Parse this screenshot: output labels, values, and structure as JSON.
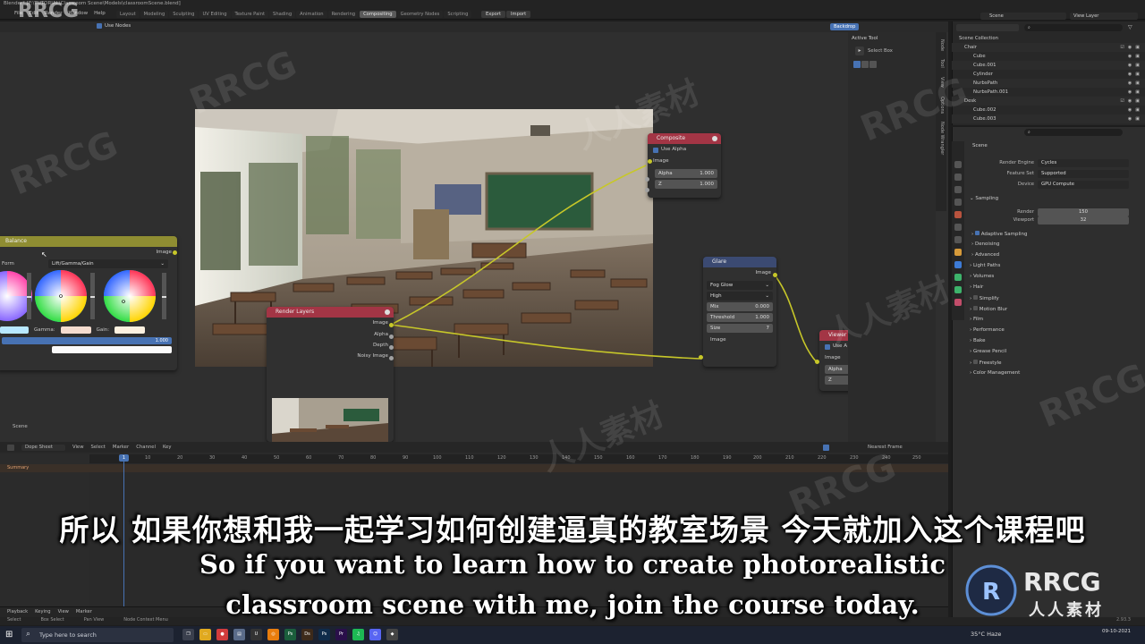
{
  "titlebar": {
    "title": "Blender* [F:\\TUTORIAL\\Classroom Scene\\Models\\classroomScene.blend]"
  },
  "menus": [
    "File",
    "Edit",
    "Render",
    "Window",
    "Help"
  ],
  "workspaces": [
    "Layout",
    "Modeling",
    "Sculpting",
    "UV Editing",
    "Texture Paint",
    "Shading",
    "Animation",
    "Rendering",
    "Compositing",
    "Geometry Nodes",
    "Scripting"
  ],
  "active_workspace": "Compositing",
  "import_export": {
    "export": "Export",
    "import": "Import"
  },
  "scene_selector": "Scene",
  "view_layer_selector": "View Layer",
  "node_editor": {
    "use_nodes": "Use Nodes",
    "backdrop": "Backdrop",
    "scene_label": "Scene",
    "nodes": {
      "color_balance": {
        "title": "Balance",
        "output": "Image",
        "formula_label": "Form",
        "formula_value": "Lift/Gamma/Gain",
        "gamma": "Gamma:",
        "gain": "Gain:",
        "fac": "1.000"
      },
      "composite": {
        "title": "Composite",
        "use_alpha": "Use Alpha",
        "image": "Image",
        "alpha": "Alpha",
        "alpha_val": "1.000",
        "z": "Z",
        "z_val": "1.000"
      },
      "glare": {
        "title": "Glare",
        "output": "Image",
        "type": "Fog Glow",
        "quality": "High",
        "mix": "Mix",
        "mix_val": "0.000",
        "threshold": "Threshold",
        "threshold_val": "1.000",
        "size": "Size",
        "size_val": "7",
        "input": "Image"
      },
      "render_layers": {
        "title": "Render Layers",
        "outputs": [
          "Image",
          "Alpha",
          "Depth",
          "Noisy Image"
        ]
      },
      "viewer": {
        "title": "Viewer",
        "use_alpha": "Use A",
        "image": "Image",
        "alpha": "Alpha",
        "z": "Z"
      }
    }
  },
  "npanel": {
    "tabs": [
      "Node",
      "Tool",
      "View",
      "Options",
      "Node Wrangler"
    ],
    "active_tool": "Active Tool",
    "select_box": "Select Box"
  },
  "outliner": {
    "rows": [
      {
        "label": "Scene Collection",
        "indent": 0
      },
      {
        "label": "Chair",
        "indent": 1
      },
      {
        "label": "Cube",
        "indent": 2
      },
      {
        "label": "Cube.001",
        "indent": 2
      },
      {
        "label": "Cylinder",
        "indent": 2
      },
      {
        "label": "NurbsPath",
        "indent": 2
      },
      {
        "label": "NurbsPath.001",
        "indent": 2
      },
      {
        "label": "Desk",
        "indent": 1
      },
      {
        "label": "Cube.002",
        "indent": 2
      },
      {
        "label": "Cube.003",
        "indent": 2
      }
    ]
  },
  "properties": {
    "context": "Scene",
    "render_engine_label": "Render Engine",
    "render_engine": "Cycles",
    "feature_set_label": "Feature Set",
    "feature_set": "Supported",
    "device_label": "Device",
    "device": "GPU Compute",
    "sampling": "Sampling",
    "render_label": "Render",
    "render_samples": "150",
    "viewport_label": "Viewport",
    "viewport_samples": "32",
    "panels": [
      "Adaptive Sampling",
      "Denoising",
      "Advanced",
      "Light Paths",
      "Volumes",
      "Hair",
      "Simplify",
      "Motion Blur",
      "Film",
      "Performance",
      "Bake",
      "Grease Pencil",
      "Freestyle",
      "Color Management"
    ]
  },
  "dope_sheet": {
    "mode": "Dope Sheet",
    "menus": [
      "View",
      "Select",
      "Marker",
      "Channel",
      "Key"
    ],
    "summary": "Summary",
    "nearest_frame": "Nearest Frame",
    "current_frame": "1",
    "ticks": [
      "10",
      "20",
      "30",
      "40",
      "50",
      "60",
      "70",
      "80",
      "90",
      "100",
      "110",
      "120",
      "130",
      "140",
      "150",
      "160",
      "170",
      "180",
      "190",
      "200",
      "210",
      "220",
      "230",
      "240",
      "250"
    ]
  },
  "timeline": {
    "menus": [
      "Playback",
      "Keying",
      "View",
      "Marker"
    ]
  },
  "status": {
    "items": [
      "Select",
      "Box Select",
      "Pan View",
      "Node Context Menu"
    ],
    "version": "2.93.3"
  },
  "taskbar": {
    "search_placeholder": "Type here to search",
    "apps": [
      "Ps",
      "Ds",
      "Ps",
      "Pr"
    ],
    "weather": "35°C  Haze",
    "time": "",
    "date": "09-10-2021"
  },
  "subtitles": {
    "zh": "所以 如果你想和我一起学习如何创建逼真的教室场景 今天就加入这个课程吧",
    "en1": "So if you want to learn how to create photorealistic",
    "en2": "classroom scene with me, join the course today."
  },
  "watermarks": {
    "rrcg": "RRCG",
    "rrcg_site": "人人素材"
  },
  "colors": {
    "accent": "#4772b3",
    "socket_yellow": "#c7c729",
    "composite_header": "#a33545",
    "glare_header": "#3b4a72",
    "balance_header": "#8f8d32"
  }
}
